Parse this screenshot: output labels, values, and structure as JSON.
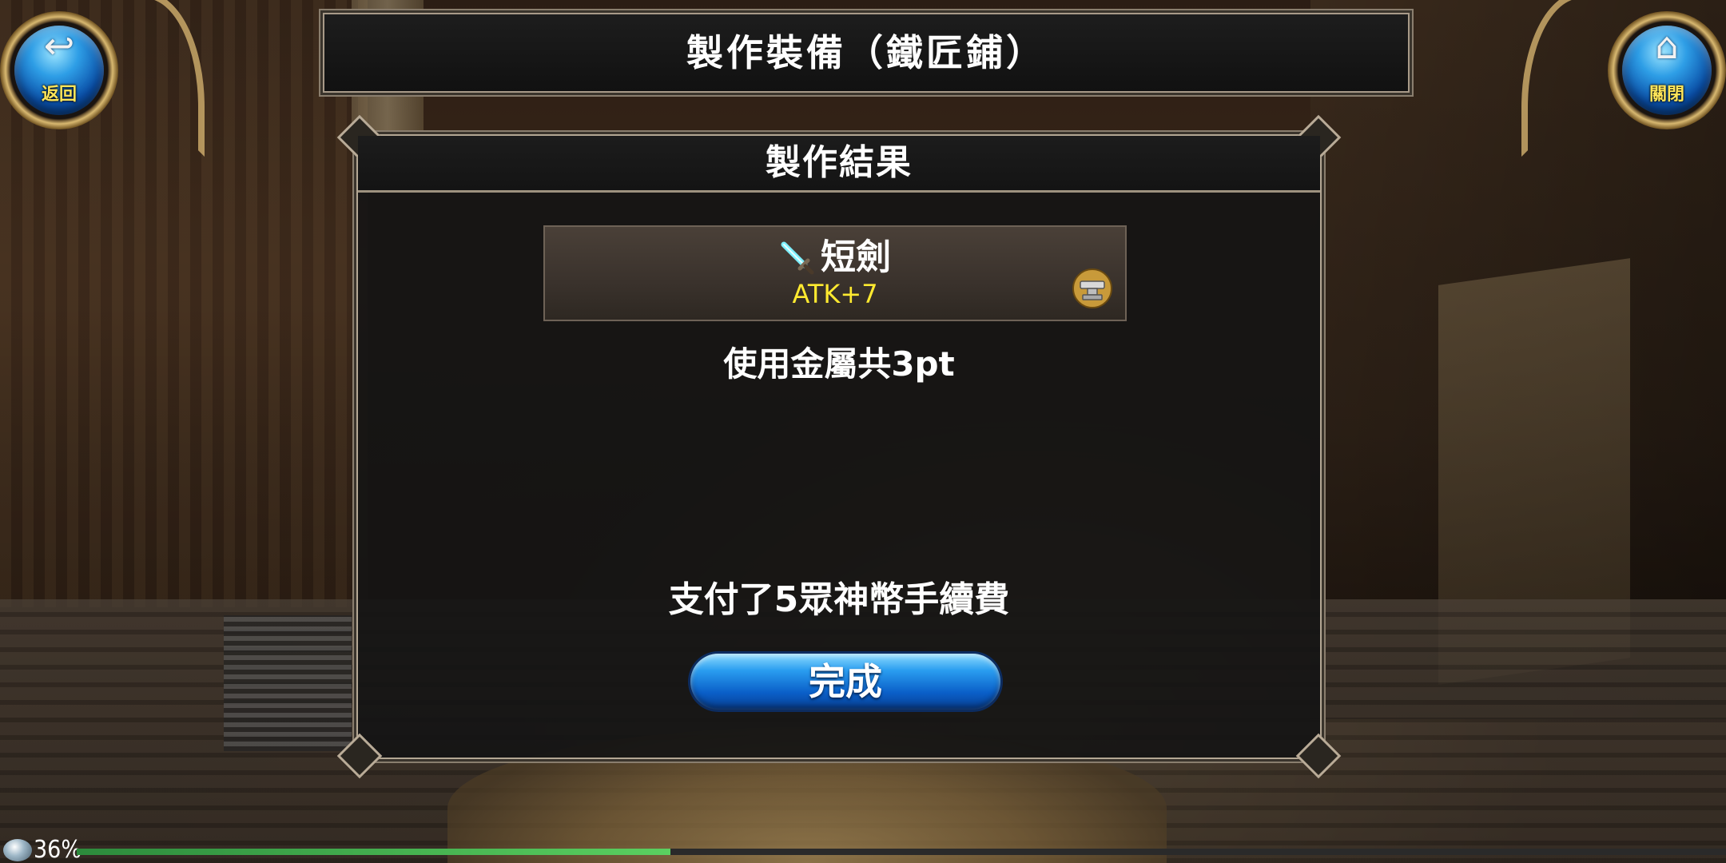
{
  "header": {
    "title": "製作裝備（鐵匠鋪）",
    "back_label": "返回",
    "back_icon": "return-arrow-icon",
    "close_label": "關閉",
    "close_icon": "home-icon"
  },
  "dialog": {
    "title": "製作結果",
    "item": {
      "name": "短劍",
      "stat": "ATK+7",
      "icon": "sword-icon",
      "badge_icon": "anvil-icon"
    },
    "metal_used": "使用金屬共3pt",
    "fee_text": "支付了5眾神幣手續費",
    "done_label": "完成"
  },
  "status": {
    "percent_label": "36%",
    "progress": 0.36,
    "fill_color": "#5ad060"
  }
}
